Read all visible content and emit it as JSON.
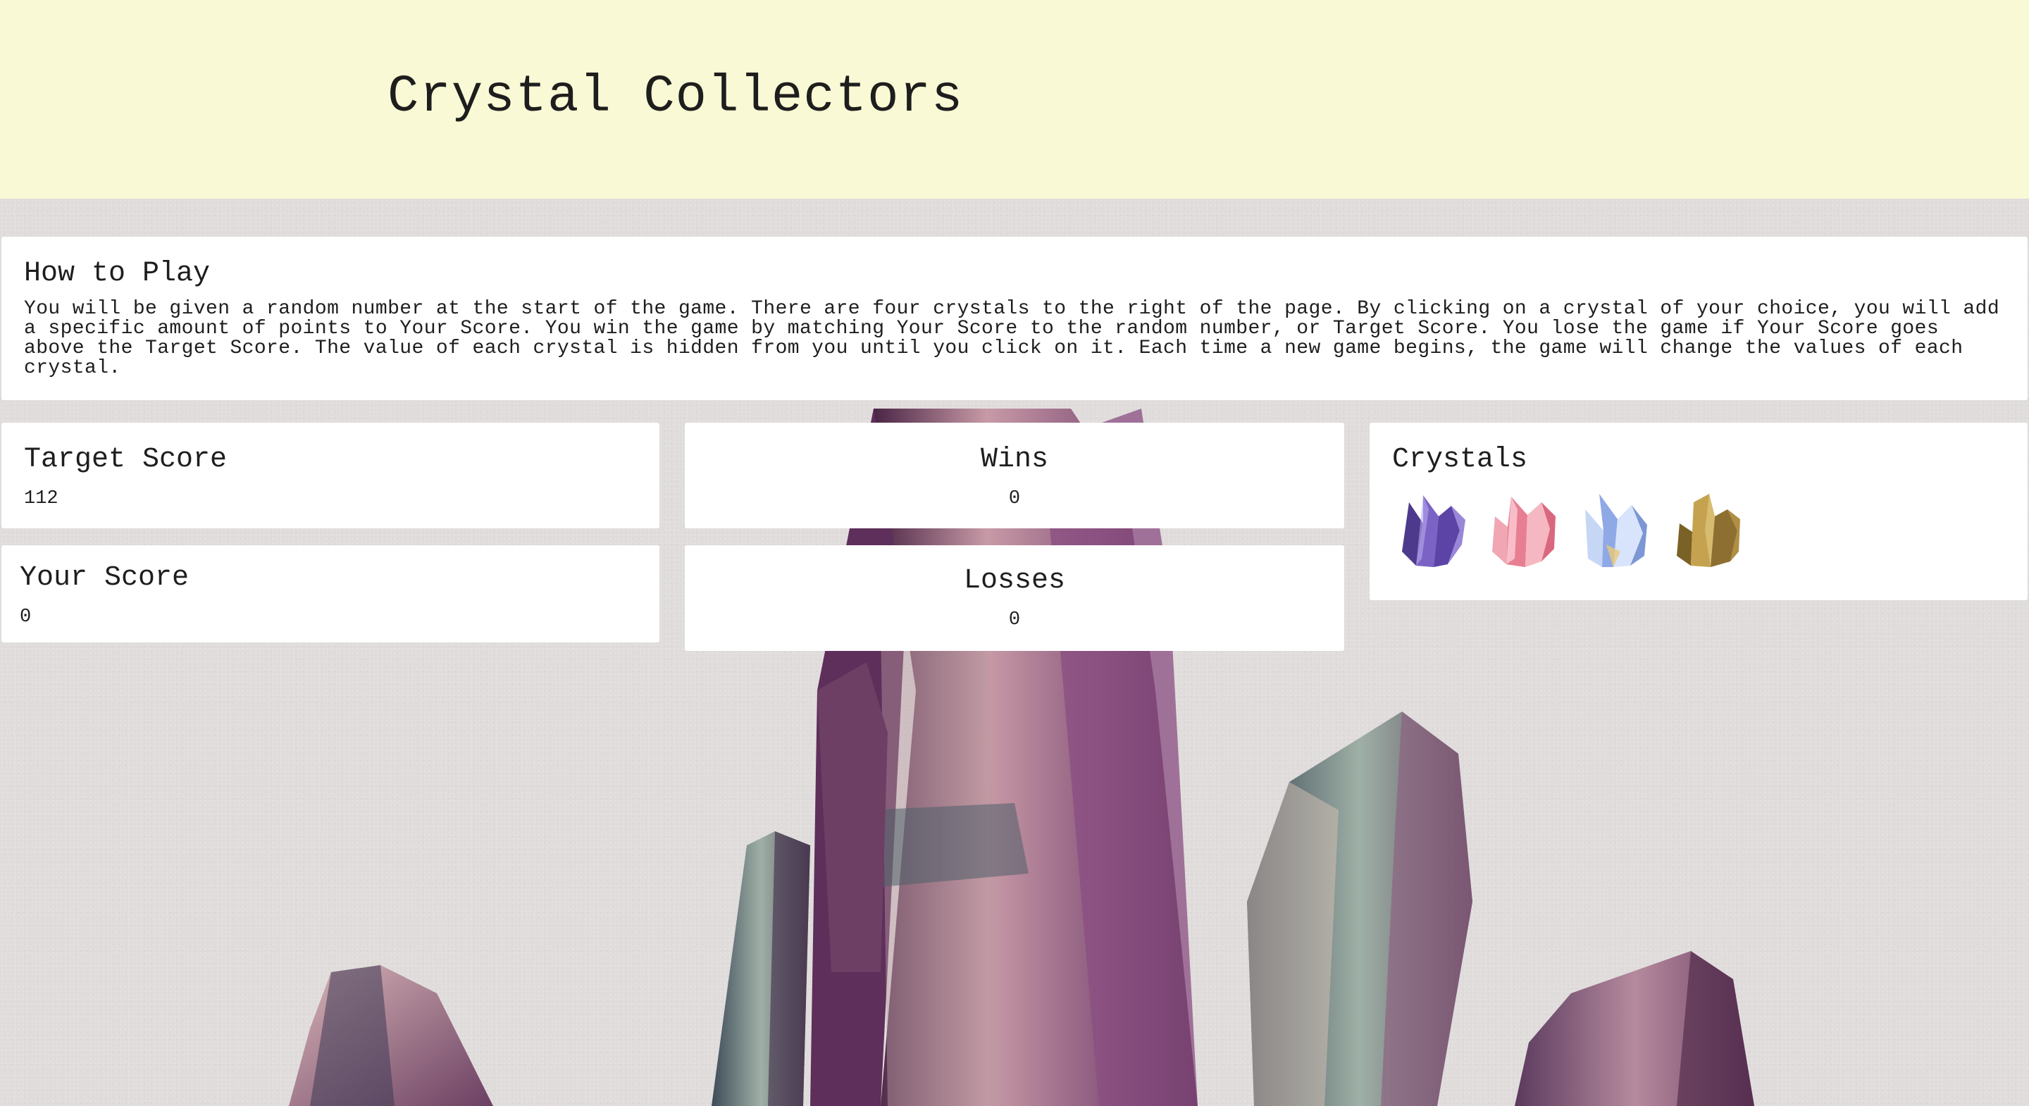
{
  "header": {
    "title": "Crystal Collectors"
  },
  "how_to_play": {
    "heading": "How to Play",
    "text": "You will be given a random number at the start of the game. There are four crystals to the right of the page. By clicking on a crystal of your choice, you will add a specific amount of points to Your Score. You win the game by matching Your Score to the random number, or Target Score. You lose the game if Your Score goes above the Target Score. The value of each crystal is hidden from you until you click on it. Each time a new game begins, the game will change the values of each crystal."
  },
  "target_score": {
    "heading": "Target Score",
    "value": "112"
  },
  "your_score": {
    "heading": "Your Score",
    "value": "0"
  },
  "wins": {
    "heading": "Wins",
    "value": "0"
  },
  "losses": {
    "heading": "Losses",
    "value": "0"
  },
  "crystals": {
    "heading": "Crystals",
    "items": [
      {
        "name": "purple-crystal",
        "color": "#6a4fa8"
      },
      {
        "name": "pink-crystal",
        "color": "#e88a98"
      },
      {
        "name": "blue-crystal",
        "color": "#9fb8e8"
      },
      {
        "name": "gold-crystal",
        "color": "#a8893a"
      }
    ]
  },
  "theme": {
    "header_bg": "#f9f9d5",
    "page_bg": "#e0dcdc",
    "card_bg": "#ffffff"
  }
}
